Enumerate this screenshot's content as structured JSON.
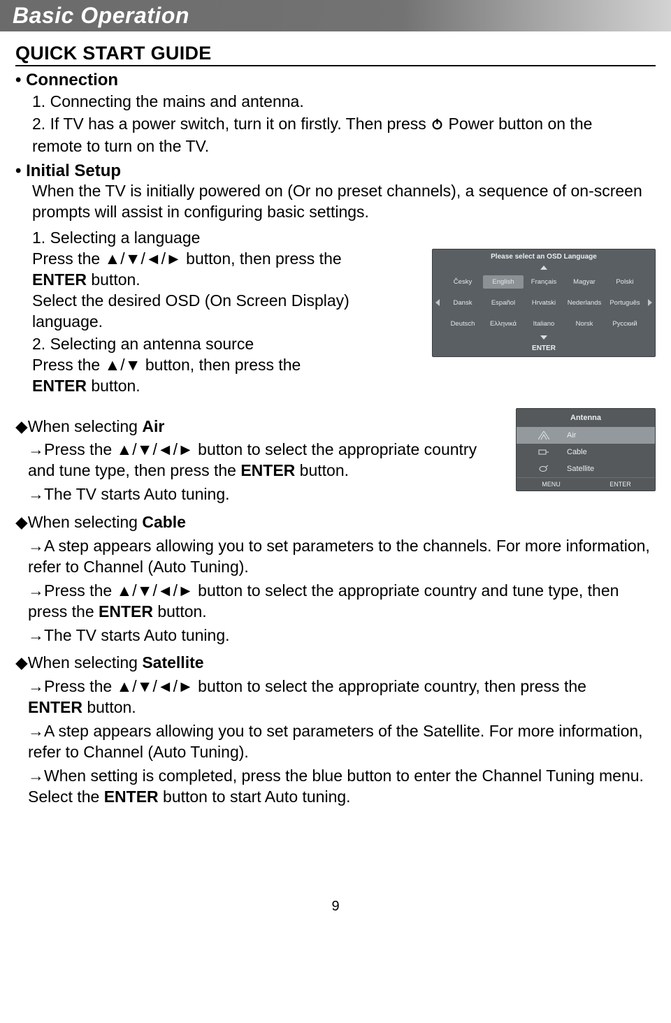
{
  "header": {
    "title": "Basic Operation"
  },
  "section_title": "QUICK START GUIDE",
  "connection": {
    "label": "• Connection",
    "item1_no": "1.",
    "item1": " Connecting the mains and antenna.",
    "item2_no": "2.",
    "item2a": " If TV has a power switch, turn it on firstly. Then press ",
    "item2b": " Power button on the",
    "item2c": "remote to turn on the TV."
  },
  "initial_setup": {
    "label": "• Initial Setup",
    "intro": "When the TV is initially powered on (Or no preset channels), a sequence of on-screen prompts will assist in configuring basic settings.",
    "s1_no": "1.",
    "s1_title": " Selecting a language",
    "s1_line1a": "Press the",
    "s1_line1b": "button, then press the",
    "s1_line2": "ENTER",
    "s1_line2b": " button.",
    "s1_line3": "Select the desired OSD (On Screen Display) language.",
    "s2_no": "2.",
    "s2_title": " Selecting an antenna source",
    "s2_line1a": "Press the",
    "s2_line1b": "button, then press the",
    "s2_line2": "ENTER",
    "s2_line2b": " button."
  },
  "air": {
    "head": "◆When selecting ",
    "opt": "Air",
    "line1a": "→Press the",
    "line1b": "button to select the appropriate country",
    "line1c": "and tune type, then press the ",
    "line1d": "ENTER",
    "line1e": " button.",
    "line2": "→The TV starts Auto tuning."
  },
  "cable": {
    "head": "◆When selecting ",
    "opt": "Cable",
    "line1": "→A step appears allowing you to set parameters to the channels. For more information, refer to Channel (Auto Tuning).",
    "line2a": "→Press the",
    "line2b": "button to select the appropriate country and tune type, then",
    "line2c": "press the ",
    "line2d": "ENTER",
    "line2e": " button.",
    "line3": "→The TV starts Auto tuning."
  },
  "satellite": {
    "head": "◆When selecting ",
    "opt": "Satellite",
    "line1a": "→Press the",
    "line1b": "button to select the appropriate country, then press the",
    "line1c": "ENTER",
    "line1d": " button.",
    "line2": "→A step appears allowing you to set parameters of the Satellite. For more information, refer to Channel (Auto Tuning).",
    "line3a": "→When setting is completed, press the blue button to enter the Channel Tuning menu. Select the ",
    "line3b": "ENTER",
    "line3c": " button to start Auto tuning."
  },
  "osd_panel": {
    "title": "Please select an OSD Language",
    "rows": [
      [
        "Česky",
        "English",
        "Français",
        "Magyar",
        "Polski"
      ],
      [
        "Dansk",
        "Español",
        "Hrvatski",
        "Nederlands",
        "Português"
      ],
      [
        "Deutsch",
        "Ελληνικά",
        "Italiano",
        "Norsk",
        "Русский"
      ]
    ],
    "footer": "ENTER",
    "selected": "English"
  },
  "antenna_panel": {
    "title": "Antenna",
    "options": [
      "Air",
      "Cable",
      "Satellite"
    ],
    "selected": "Air",
    "footer_left": "MENU",
    "footer_right": "ENTER"
  },
  "page_number": "9"
}
